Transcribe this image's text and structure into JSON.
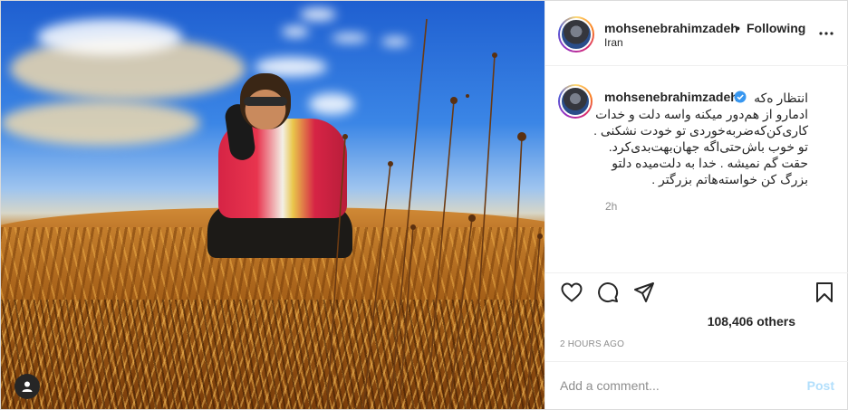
{
  "header": {
    "username": "mohsenebrahimzadeh",
    "separator": "•",
    "follow_status": "Following",
    "location": "Iran",
    "more_icon": "more-horizontal-icon"
  },
  "caption": {
    "username": "mohsenebrahimzadeh",
    "verified_icon": "verified-badge-icon",
    "lines": [
      "انتظار ه‌که",
      "ادمارو از هم‌دور میکنه واسه دلت و خدات",
      "کاری‌کن‌که‌ضربه‌خوردی تو خودت نشکنی .",
      "تو خوب باش‌حتی‌اگه جهان‌بهت‌بدی‌کرد.",
      "حقت گم نمیشه . خدا به دلت‌میده دلتو",
      "بزرگ کن خواسته‌هاتم بزرگتر ."
    ],
    "time": "2h"
  },
  "actions": {
    "like_icon": "heart-icon",
    "comment_icon": "comment-icon",
    "share_icon": "share-icon",
    "save_icon": "bookmark-icon"
  },
  "likes": "108,406 others",
  "timestamp": "2 HOURS AGO",
  "comment": {
    "placeholder": "Add a comment...",
    "value": "",
    "post_label": "Post",
    "post_color": "#b2dffc"
  },
  "media": {
    "user_tag_icon": "user-tag-icon"
  }
}
